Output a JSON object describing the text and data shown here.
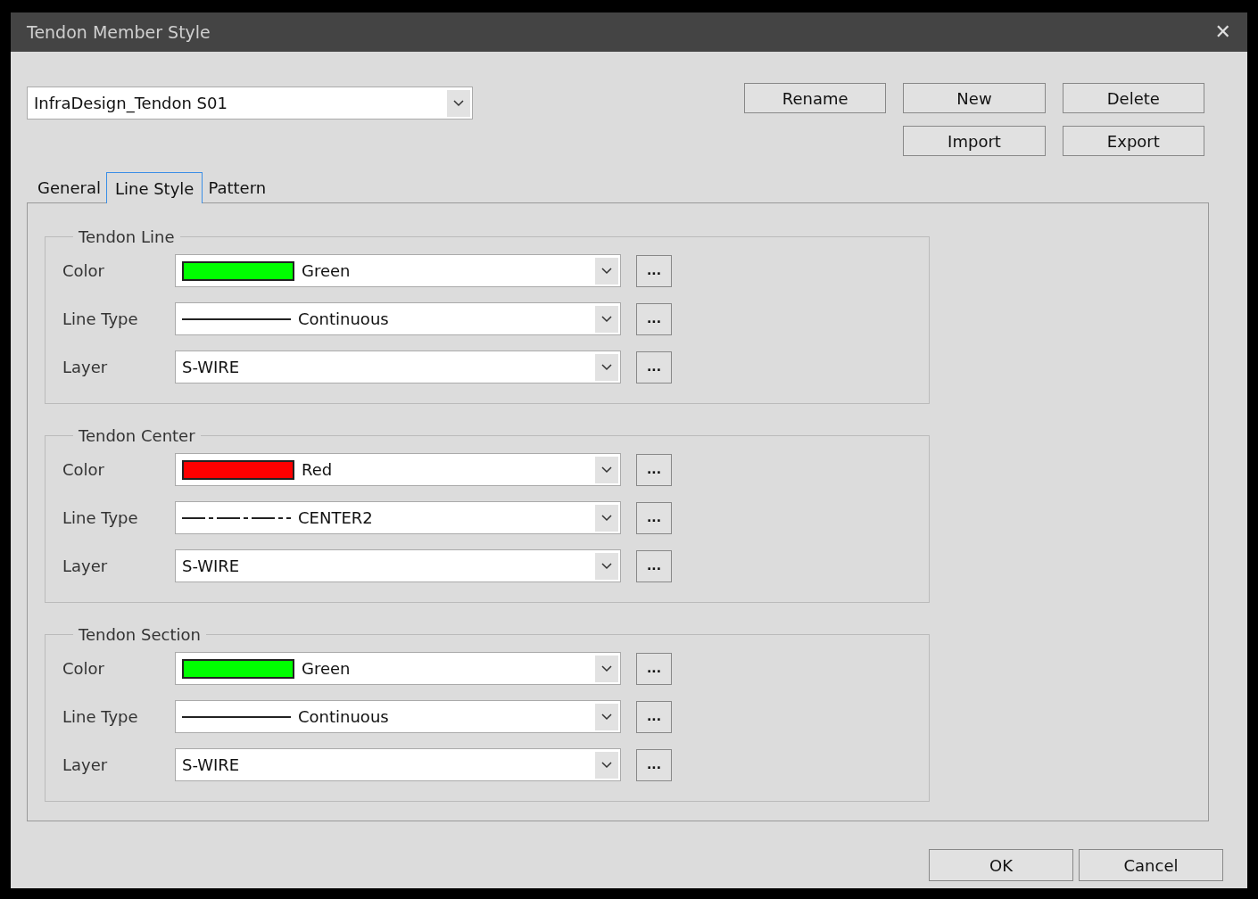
{
  "window": {
    "title": "Tendon Member Style",
    "close": "✕"
  },
  "style_select": {
    "value": "InfraDesign_Tendon S01"
  },
  "top_buttons": [
    {
      "label": "Rename"
    },
    {
      "label": "New"
    },
    {
      "label": "Delete"
    },
    {
      "label": "Import"
    },
    {
      "label": "Export"
    }
  ],
  "tabs": [
    {
      "label": "General",
      "selected": false
    },
    {
      "label": "Line Style",
      "selected": true
    },
    {
      "label": "Pattern",
      "selected": false
    }
  ],
  "groups": [
    {
      "title": "Tendon Line",
      "rows": [
        {
          "label": "Color",
          "kind": "color",
          "color": "#00ff00",
          "value": "Green",
          "more": "..."
        },
        {
          "label": "Line Type",
          "kind": "continuous_line",
          "value": "Continuous",
          "more": "..."
        },
        {
          "label": "Layer",
          "kind": "text",
          "value": "S-WIRE",
          "more": "..."
        }
      ]
    },
    {
      "title": "Tendon Center",
      "rows": [
        {
          "label": "Color",
          "kind": "color",
          "color": "#ff0000",
          "value": "Red",
          "more": "..."
        },
        {
          "label": "Line Type",
          "kind": "center_line",
          "value": "CENTER2",
          "more": "..."
        },
        {
          "label": "Layer",
          "kind": "text",
          "value": "S-WIRE",
          "more": "..."
        }
      ]
    },
    {
      "title": "Tendon Section",
      "rows": [
        {
          "label": "Color",
          "kind": "color",
          "color": "#00ff00",
          "value": "Green",
          "more": "..."
        },
        {
          "label": "Line Type",
          "kind": "continuous_line",
          "value": "Continuous",
          "more": "..."
        },
        {
          "label": "Layer",
          "kind": "text",
          "value": "S-WIRE",
          "more": "..."
        }
      ]
    }
  ],
  "footer_buttons": [
    {
      "label": "OK"
    },
    {
      "label": "Cancel"
    }
  ]
}
